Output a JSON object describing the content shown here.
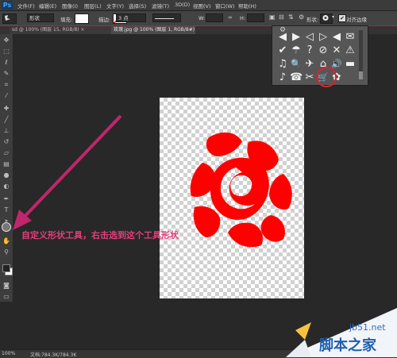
{
  "app": {
    "logo": "Ps"
  },
  "menu": {
    "items": [
      "文件(F)",
      "编辑(E)",
      "图像(I)",
      "图层(L)",
      "文字(Y)",
      "选择(S)",
      "滤镜(T)",
      "3D(D)",
      "视图(V)",
      "窗口(W)",
      "帮助(H)"
    ]
  },
  "options": {
    "mode_value": "形状",
    "fill_label": "填充:",
    "stroke_label": "描边:",
    "stroke_size": "3 点",
    "w_label": "W:",
    "h_label": "H:",
    "shape_label": "形状:",
    "align_edges_label": "对齐边缘",
    "align_edges_checked": true
  },
  "tabs": [
    {
      "label": "sd @ 100% (图层 15, RGB/8) ×"
    },
    {
      "label": "玫瑰.jpg @ 100% (图层 1, RGB/8#) * ×"
    }
  ],
  "shape_picker": {
    "shapes": [
      "◀",
      "▶",
      "◁",
      "▷",
      "◀",
      "✉",
      "✔",
      "☂",
      "?",
      "⊘",
      "✕",
      "⚠",
      "♫",
      "🔍",
      "✈",
      "⌂",
      "🔊",
      "▬",
      "♪",
      "☎",
      "✂",
      "🛒",
      "✿"
    ],
    "selected_index": 22,
    "highlight_color": "#d9232d"
  },
  "canvas": {
    "shape_name": "rose",
    "shape_color": "#ff0000"
  },
  "annotation": {
    "text": "自定义形状工具，右击选到这个工具形状",
    "color": "#e43f7a"
  },
  "status": {
    "zoom": "100%",
    "doc": "文档:784.3K/784.3K"
  },
  "watermark": {
    "url": "jb51.net",
    "name": "脚本之家"
  }
}
